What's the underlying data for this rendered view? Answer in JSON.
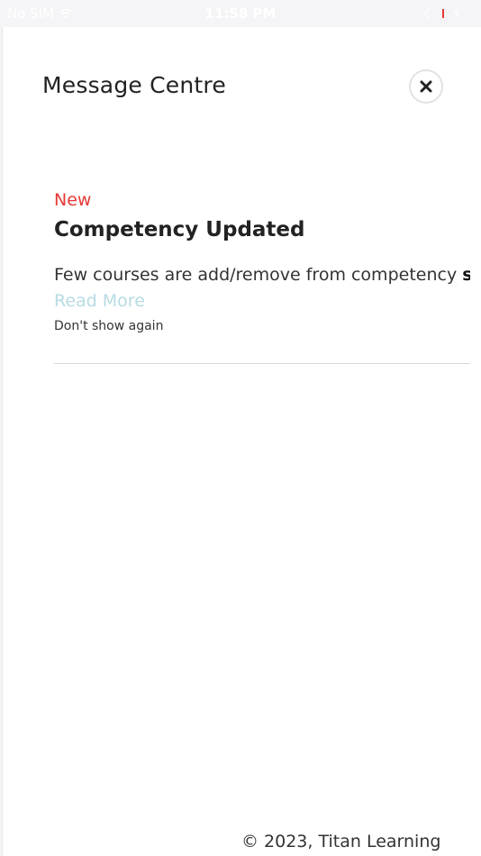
{
  "status_bar": {
    "carrier": "No SIM",
    "time": "11:58 PM"
  },
  "panel": {
    "title": "Message Centre"
  },
  "message": {
    "badge": "New",
    "title": "Competency Updated",
    "body_text": "Few courses are add/remove from competency ",
    "body_bold": "sh",
    "body_ellipsis": "...",
    "read_more": "Read More",
    "dont_show": "Don't show again"
  },
  "footer": {
    "copyright": "© 2023, Titan Learning"
  },
  "colors": {
    "badge": "#e53935",
    "link": "#b8dbe3",
    "text": "#222222"
  },
  "icons": {
    "close": "close-icon",
    "wifi": "wifi-icon",
    "battery": "battery-icon"
  }
}
